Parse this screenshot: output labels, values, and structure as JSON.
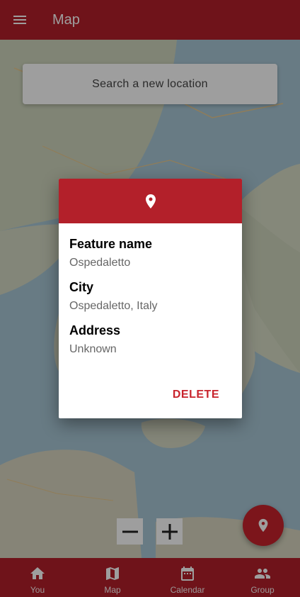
{
  "colors": {
    "primary": "#b3202a",
    "accent": "#c8232c",
    "on_primary": "#ffffff"
  },
  "appbar": {
    "menu_icon": "menu-icon",
    "title": "Map"
  },
  "search": {
    "placeholder": "Search a new location"
  },
  "zoom": {
    "out_icon": "minus-icon",
    "in_icon": "plus-icon"
  },
  "fab": {
    "icon": "location-pin-icon"
  },
  "dialog": {
    "header_icon": "location-pin-icon",
    "fields": [
      {
        "label": "Feature name",
        "value": "Ospedaletto"
      },
      {
        "label": "City",
        "value": "Ospedaletto, Italy"
      },
      {
        "label": "Address",
        "value": "Unknown"
      }
    ],
    "delete_label": "DELETE"
  },
  "bottom_nav": {
    "items": [
      {
        "label": "You",
        "icon": "home-icon"
      },
      {
        "label": "Map",
        "icon": "map-icon"
      },
      {
        "label": "Calendar",
        "icon": "calendar-icon"
      },
      {
        "label": "Group",
        "icon": "group-icon"
      }
    ]
  }
}
